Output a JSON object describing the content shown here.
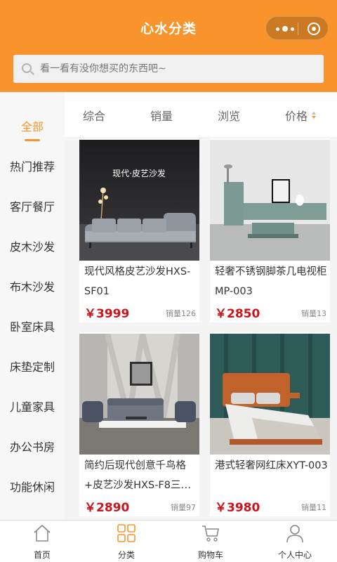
{
  "header": {
    "title": "心水分类"
  },
  "search": {
    "placeholder": "看一看有没你想买的东西吧~"
  },
  "colors": {
    "brand": "#f8942b",
    "price": "#c8161d"
  },
  "sidebar": {
    "items": [
      {
        "label": "全部",
        "active": true
      },
      {
        "label": "热门推荐"
      },
      {
        "label": "客厅餐厅"
      },
      {
        "label": "皮木沙发"
      },
      {
        "label": "布木沙发"
      },
      {
        "label": "卧室床具"
      },
      {
        "label": "床垫定制"
      },
      {
        "label": "儿童家具"
      },
      {
        "label": "办公书房"
      },
      {
        "label": "功能休闲"
      }
    ]
  },
  "sort": {
    "items": [
      "综合",
      "销量",
      "浏览",
      "价格"
    ]
  },
  "products": [
    {
      "name": "现代风格皮艺沙发HXS-SF01",
      "price": "￥3999",
      "sales": "销量126",
      "image_text": "现代·皮艺沙发"
    },
    {
      "name": "轻奢不锈钢脚茶几电视柜MP-003",
      "price": "￥2850",
      "sales": "销量13"
    },
    {
      "name": "简约后现代创意千鸟格+皮艺沙发HXS-F8三…",
      "price": "￥2890",
      "sales": "销量97"
    },
    {
      "name": "港式轻奢网红床XYT-003",
      "price": "￥3980",
      "sales": "销量11"
    }
  ],
  "tabbar": {
    "items": [
      {
        "label": "首页",
        "icon": "home-icon"
      },
      {
        "label": "分类",
        "icon": "category-icon",
        "active": true
      },
      {
        "label": "购物车",
        "icon": "cart-icon"
      },
      {
        "label": "个人中心",
        "icon": "user-icon"
      }
    ]
  }
}
